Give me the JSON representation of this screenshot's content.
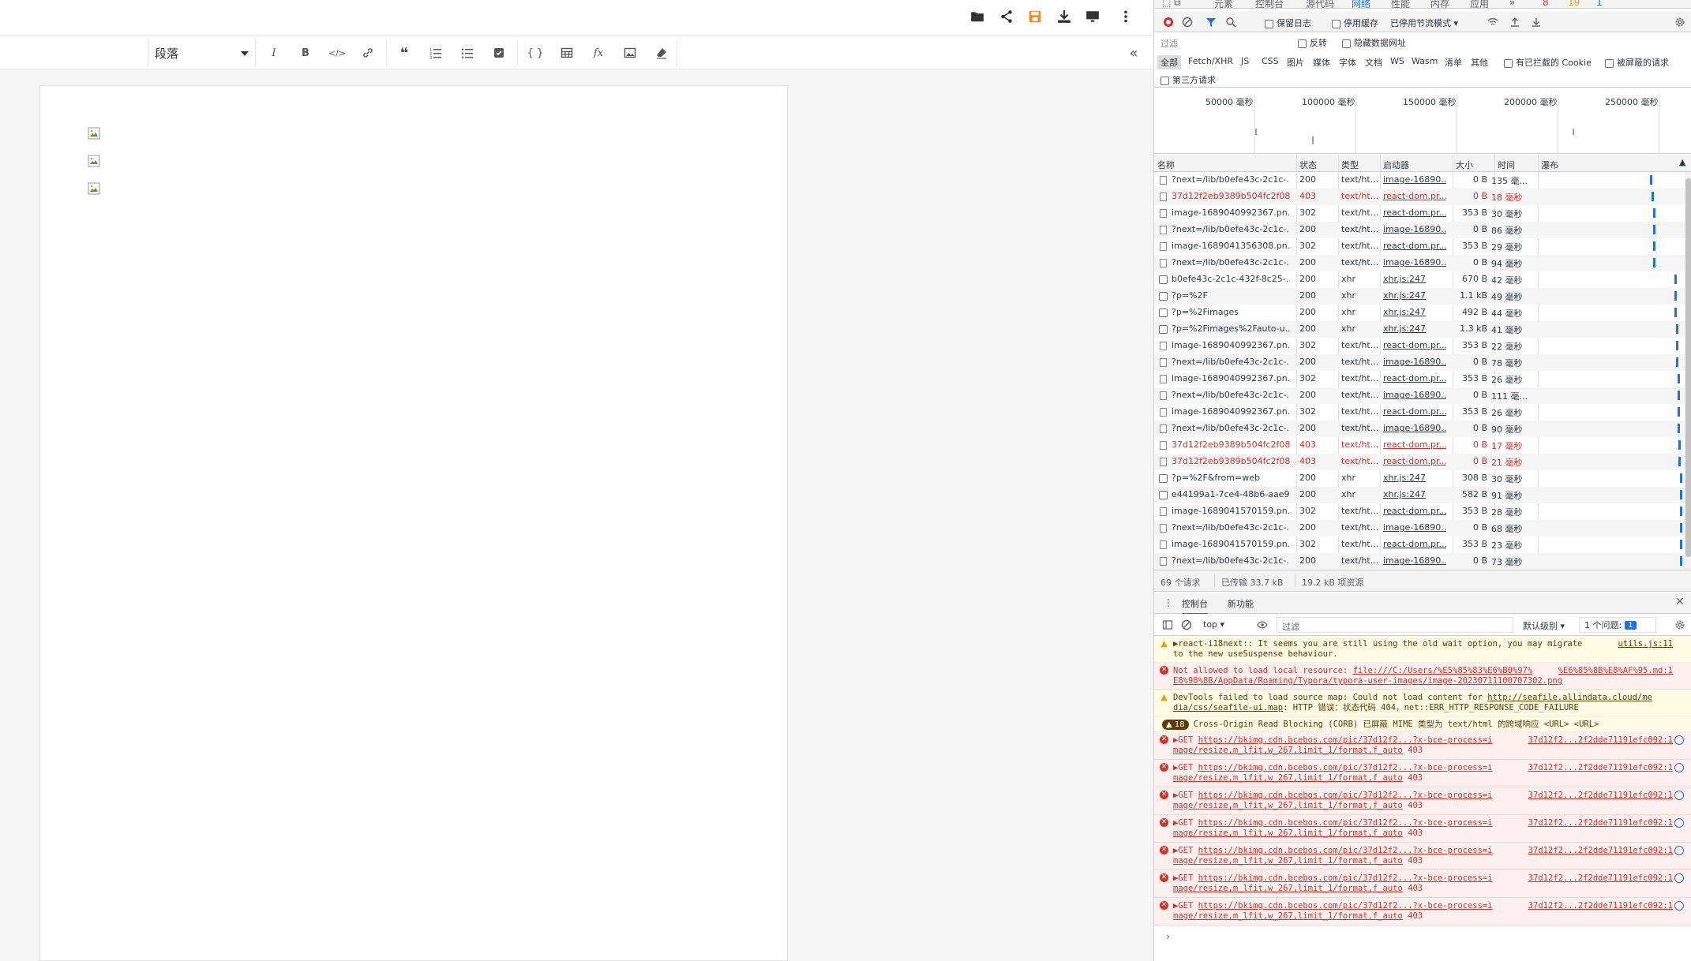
{
  "editor": {
    "toolbar_icons": [
      "folder-icon",
      "share-icon",
      "save-icon",
      "download-icon",
      "monitor-icon",
      "more-icon"
    ],
    "paragraph_select": "段落",
    "format_buttons": [
      "italic-icon",
      "bold-icon",
      "code-icon",
      "link-icon",
      "quote-icon",
      "ordered-list-icon",
      "unordered-list-icon",
      "checklist-icon",
      "code-block-icon",
      "table-icon",
      "formula-icon",
      "image-icon",
      "clear-format-icon"
    ],
    "collapse": "«",
    "broken_images": 3
  },
  "devtools": {
    "panel_tabs": [
      "元素",
      "控制台",
      "源代码",
      "网络",
      "性能",
      "内存",
      "应用",
      "»"
    ],
    "badges": {
      "errors": "8",
      "warnings": "19",
      "info": "1"
    },
    "net_toolbar": {
      "preserve_log": "保留日志",
      "disable_cache": "停用缓存",
      "throttling": "已停用节流模式"
    },
    "filter": {
      "placeholder": "过滤",
      "invert": "反转",
      "hide_data_urls": "隐藏数据网址"
    },
    "types": [
      "全部",
      "Fetch/XHR",
      "JS",
      "CSS",
      "图片",
      "媒体",
      "字体",
      "文档",
      "WS",
      "Wasm",
      "清单",
      "其他"
    ],
    "blocked_cookies": "有已拦截的 Cookie",
    "blocked_requests": "被屏蔽的请求",
    "third_party": "第三方请求",
    "timeline_ticks": [
      "50000 毫秒",
      "100000 毫秒",
      "150000 毫秒",
      "200000 毫秒",
      "250000 毫秒"
    ],
    "columns": {
      "name": "名称",
      "status": "状态",
      "type": "类型",
      "initiator": "启动器",
      "size": "大小",
      "time": "时间",
      "waterfall": "瀑布"
    },
    "requests": [
      {
        "name": "?next=/lib/b0efe43c-2c1c-...",
        "status": "200",
        "type": "text/ht...",
        "initiator": "image-16890...",
        "size": "0 B",
        "time": "135 毫...",
        "error": false,
        "kind": "doc",
        "wf": 0.78
      },
      {
        "name": "37d12f2eb9389b504fc2f08...",
        "status": "403",
        "type": "text/ht...",
        "initiator": "react-dom.pr...",
        "size": "0 B",
        "time": "18 毫秒",
        "error": true,
        "kind": "doc",
        "wf": 0.79
      },
      {
        "name": "image-1689040992367.pn...",
        "status": "302",
        "type": "text/ht...",
        "initiator": "react-dom.pr...",
        "size": "353 B",
        "time": "30 毫秒",
        "error": false,
        "kind": "doc",
        "wf": 0.8
      },
      {
        "name": "?next=/lib/b0efe43c-2c1c-...",
        "status": "200",
        "type": "text/ht...",
        "initiator": "image-16890...",
        "size": "0 B",
        "time": "86 毫秒",
        "error": false,
        "kind": "doc",
        "wf": 0.8
      },
      {
        "name": "image-1689041356308.pn...",
        "status": "302",
        "type": "text/ht...",
        "initiator": "react-dom.pr...",
        "size": "353 B",
        "time": "29 毫秒",
        "error": false,
        "kind": "doc",
        "wf": 0.8
      },
      {
        "name": "?next=/lib/b0efe43c-2c1c-...",
        "status": "200",
        "type": "text/ht...",
        "initiator": "image-16890...",
        "size": "0 B",
        "time": "94 毫秒",
        "error": false,
        "kind": "doc",
        "wf": 0.8
      },
      {
        "name": "b0efe43c-2c1c-432f-8c25-...",
        "status": "200",
        "type": "xhr",
        "initiator": "xhr.js:247",
        "size": "670 B",
        "time": "42 毫秒",
        "error": false,
        "kind": "xhr",
        "wf": 0.95
      },
      {
        "name": "?p=%2F",
        "status": "200",
        "type": "xhr",
        "initiator": "xhr.js:247",
        "size": "1.1 kB",
        "time": "49 毫秒",
        "error": false,
        "kind": "xhr",
        "wf": 0.95
      },
      {
        "name": "?p=%2Fimages",
        "status": "200",
        "type": "xhr",
        "initiator": "xhr.js:247",
        "size": "492 B",
        "time": "44 毫秒",
        "error": false,
        "kind": "xhr",
        "wf": 0.95
      },
      {
        "name": "?p=%2Fimages%2Fauto-u...",
        "status": "200",
        "type": "xhr",
        "initiator": "xhr.js:247",
        "size": "1.3 kB",
        "time": "41 毫秒",
        "error": false,
        "kind": "xhr",
        "wf": 0.96
      },
      {
        "name": "image-1689040992367.pn...",
        "status": "302",
        "type": "text/ht...",
        "initiator": "react-dom.pr...",
        "size": "353 B",
        "time": "22 毫秒",
        "error": false,
        "kind": "doc",
        "wf": 0.96
      },
      {
        "name": "?next=/lib/b0efe43c-2c1c-...",
        "status": "200",
        "type": "text/ht...",
        "initiator": "image-16890...",
        "size": "0 B",
        "time": "78 毫秒",
        "error": false,
        "kind": "doc",
        "wf": 0.96
      },
      {
        "name": "image-1689040992367.pn...",
        "status": "302",
        "type": "text/ht...",
        "initiator": "react-dom.pr...",
        "size": "353 B",
        "time": "26 毫秒",
        "error": false,
        "kind": "doc",
        "wf": 0.97
      },
      {
        "name": "?next=/lib/b0efe43c-2c1c-...",
        "status": "200",
        "type": "text/ht...",
        "initiator": "image-16890...",
        "size": "0 B",
        "time": "111 毫...",
        "error": false,
        "kind": "doc",
        "wf": 0.97
      },
      {
        "name": "image-1689040992367.pn...",
        "status": "302",
        "type": "text/ht...",
        "initiator": "react-dom.pr...",
        "size": "353 B",
        "time": "26 毫秒",
        "error": false,
        "kind": "doc",
        "wf": 0.97
      },
      {
        "name": "?next=/lib/b0efe43c-2c1c-...",
        "status": "200",
        "type": "text/ht...",
        "initiator": "image-16890...",
        "size": "0 B",
        "time": "90 毫秒",
        "error": false,
        "kind": "doc",
        "wf": 0.97
      },
      {
        "name": "37d12f2eb9389b504fc2f08...",
        "status": "403",
        "type": "text/ht...",
        "initiator": "react-dom.pr...",
        "size": "0 B",
        "time": "17 毫秒",
        "error": true,
        "kind": "doc",
        "wf": 0.98
      },
      {
        "name": "37d12f2eb9389b504fc2f08...",
        "status": "403",
        "type": "text/ht...",
        "initiator": "react-dom.pr...",
        "size": "0 B",
        "time": "21 毫秒",
        "error": true,
        "kind": "doc",
        "wf": 0.98
      },
      {
        "name": "?p=%2F&from=web",
        "status": "200",
        "type": "xhr",
        "initiator": "xhr.js:247",
        "size": "308 B",
        "time": "30 毫秒",
        "error": false,
        "kind": "xhr",
        "wf": 0.99
      },
      {
        "name": "e44199a1-7ce4-48b6-aae9...",
        "status": "200",
        "type": "xhr",
        "initiator": "xhr.js:247",
        "size": "582 B",
        "time": "91 毫秒",
        "error": false,
        "kind": "xhr",
        "wf": 0.99
      },
      {
        "name": "image-1689041570159.pn...",
        "status": "302",
        "type": "text/ht...",
        "initiator": "react-dom.pr...",
        "size": "353 B",
        "time": "28 毫秒",
        "error": false,
        "kind": "doc",
        "wf": 0.99
      },
      {
        "name": "?next=/lib/b0efe43c-2c1c-...",
        "status": "200",
        "type": "text/ht...",
        "initiator": "image-16890...",
        "size": "0 B",
        "time": "68 毫秒",
        "error": false,
        "kind": "doc",
        "wf": 0.99
      },
      {
        "name": "image-1689041570159.pn...",
        "status": "302",
        "type": "text/ht...",
        "initiator": "react-dom.pr...",
        "size": "353 B",
        "time": "23 毫秒",
        "error": false,
        "kind": "doc",
        "wf": 0.99
      },
      {
        "name": "?next=/lib/b0efe43c-2c1c-...",
        "status": "200",
        "type": "text/ht...",
        "initiator": "image-16890...",
        "size": "0 B",
        "time": "73 毫秒",
        "error": false,
        "kind": "doc",
        "wf": 0.99
      }
    ],
    "summary": {
      "requests": "69 个请求",
      "transferred": "已传输 33.7 kB",
      "resources": "19.2 kB 项资源"
    },
    "drawer_tabs": [
      "控制台",
      "新功能"
    ],
    "console_toolbar": {
      "context": "top",
      "filter_placeholder": "过滤",
      "levels": "默认级别",
      "issues": "1 个问题:",
      "issues_count": "1"
    },
    "console": {
      "warn1": {
        "line1": "▶react-i18next:: It seems you are still using the old wait option, you may migrate",
        "line2": "to the new useSuspense behaviour.",
        "src": "utils.js:11"
      },
      "error1": {
        "prefix": "Not allowed to load local resource: ",
        "url1": "file:///C:/Users/%E5%85%83%E6%B0%97%",
        "url2": "%E6%85%8B%E8%AF%95.md:1",
        "line2": "E8%98%8B/AppData/Roaming/Typora/typora-user-images/image-20230711100707302.png"
      },
      "warn2": {
        "prefix": "DevTools failed to load source map: Could not load content for ",
        "url1": "http://seafile.allindata.cloud/me",
        "line2_url": "dia/css/seafile-ui.map",
        "line2_rest": ": HTTP 错误：状态代码 404，net::ERR_HTTP_RESPONSE_CODE_FAILURE"
      },
      "corb": {
        "count": "18",
        "text": "Cross-Origin Read Blocking (CORB) 已屏蔽 MIME 类型为 text/html 的跨域响应 <URL> <URL>"
      },
      "get_error": {
        "method": "▶GET ",
        "url1": "https://bkimg.cdn.bcebos.com/pic/37d12f2...?x-bce-process=i",
        "line2": "mage/resize,m_lfit,w_267,limit_1/format,f_auto",
        "status": " 403",
        "src": "37d12f2...2f2dde71191efc092:1"
      },
      "get_error_count": 7
    }
  }
}
